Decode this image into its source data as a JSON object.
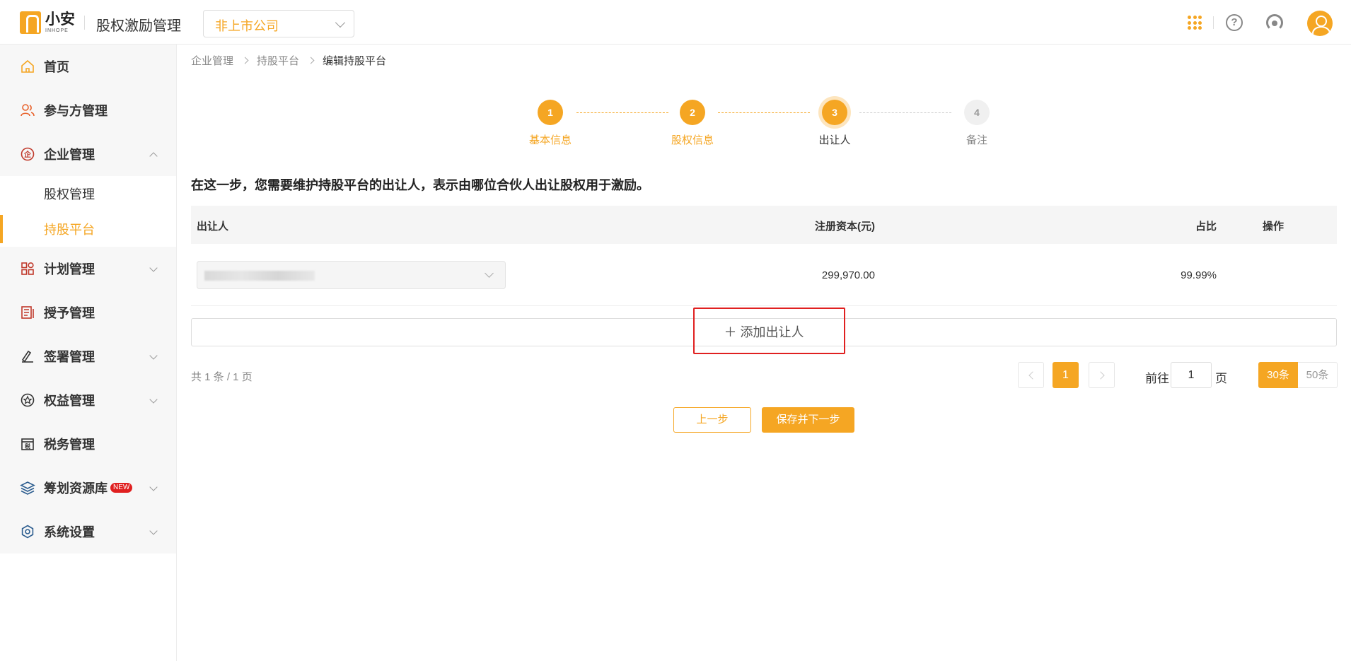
{
  "header": {
    "logo_cn": "小安",
    "logo_en": "INHOPE",
    "app_title": "股权激励管理",
    "company_select": "非上市公司"
  },
  "sidebar": {
    "items": [
      {
        "label": "首页",
        "icon": "home-icon"
      },
      {
        "label": "参与方管理",
        "icon": "people-icon"
      },
      {
        "label": "企业管理",
        "icon": "enterprise-icon",
        "expanded": true,
        "children": [
          {
            "label": "股权管理",
            "active": false
          },
          {
            "label": "持股平台",
            "active": true
          }
        ]
      },
      {
        "label": "计划管理",
        "icon": "plan-icon"
      },
      {
        "label": "授予管理",
        "icon": "grant-icon"
      },
      {
        "label": "签署管理",
        "icon": "sign-icon"
      },
      {
        "label": "权益管理",
        "icon": "equity-icon"
      },
      {
        "label": "税务管理",
        "icon": "tax-icon"
      },
      {
        "label": "筹划资源库",
        "icon": "layers-icon",
        "badge": "NEW"
      },
      {
        "label": "系统设置",
        "icon": "settings-icon"
      }
    ]
  },
  "breadcrumb": [
    "企业管理",
    "持股平台",
    "编辑持股平台"
  ],
  "steps": [
    {
      "num": "1",
      "label": "基本信息",
      "state": "done"
    },
    {
      "num": "2",
      "label": "股权信息",
      "state": "done"
    },
    {
      "num": "3",
      "label": "出让人",
      "state": "current"
    },
    {
      "num": "4",
      "label": "备注",
      "state": "pending"
    }
  ],
  "intro": "在这一步，您需要维护持股平台的出让人，表示由哪位合伙人出让股权用于激励。",
  "table": {
    "headers": [
      "出让人",
      "注册资本(元)",
      "占比",
      "操作"
    ],
    "rows": [
      {
        "transferor": "",
        "capital": "299,970.00",
        "ratio": "99.99%"
      }
    ]
  },
  "add_button": "＋ 添加出让人",
  "pagination": {
    "total": "共 1 条 / 1 页",
    "current_page": "1",
    "goto_label": "前往",
    "goto_value": "1",
    "goto_unit": "页",
    "sizes": [
      "30条",
      "50条"
    ]
  },
  "actions": {
    "prev": "上一步",
    "next": "保存并下一步"
  },
  "colors": {
    "accent": "#f5a623",
    "highlight": "#e02020"
  }
}
